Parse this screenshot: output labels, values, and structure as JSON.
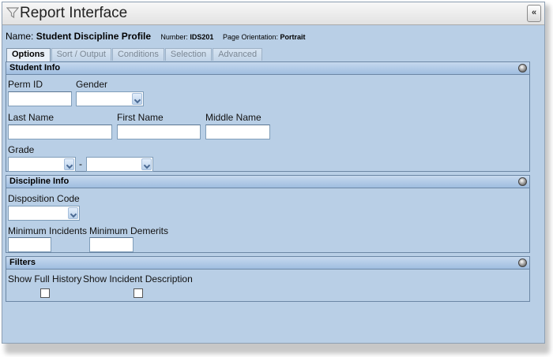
{
  "window": {
    "title": "Report Interface",
    "collapse_glyph": "«",
    "icons": {
      "title": "funnel-icon",
      "collapse": "double-chevron-left-icon"
    }
  },
  "report": {
    "name_label": "Name:",
    "name_value": "Student Discipline Profile",
    "number_label": "Number:",
    "number_value": "IDS201",
    "orientation_label": "Page Orientation:",
    "orientation_value": "Portrait"
  },
  "tabs": [
    {
      "label": "Options",
      "active": true
    },
    {
      "label": "Sort / Output",
      "active": false
    },
    {
      "label": "Conditions",
      "active": false
    },
    {
      "label": "Selection",
      "active": false
    },
    {
      "label": "Advanced",
      "active": false
    }
  ],
  "student_info": {
    "title": "Student Info",
    "perm_id_label": "Perm ID",
    "gender_label": "Gender",
    "last_name_label": "Last Name",
    "first_name_label": "First Name",
    "middle_name_label": "Middle Name",
    "grade_label": "Grade",
    "grade_separator": "-"
  },
  "discipline_info": {
    "title": "Discipline Info",
    "disposition_code_label": "Disposition Code",
    "min_incidents_label": "Minimum Incidents",
    "min_demerits_label": "Minimum Demerits"
  },
  "filters": {
    "title": "Filters",
    "show_full_history_label": "Show Full History",
    "show_incident_description_label": "Show Incident Description"
  },
  "colors": {
    "panel_background": "#b9cfe6",
    "section_header": "#9fbde0",
    "active_tab": "#e9f0f8"
  }
}
